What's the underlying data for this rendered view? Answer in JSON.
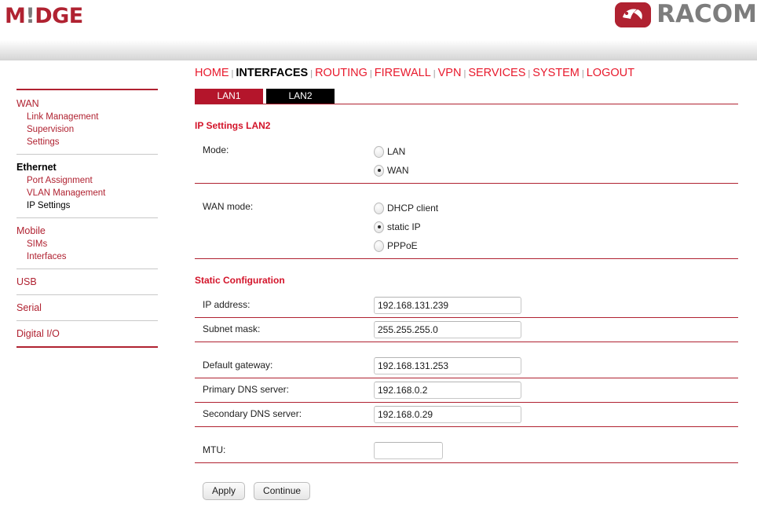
{
  "header": {
    "product_name": "M!DGE",
    "product_name_prefix": "M",
    "product_name_bang": "!",
    "product_name_suffix": "DGE",
    "company_name": "RACOM",
    "logo_icon": "racom-leaf-icon"
  },
  "topnav": {
    "items": [
      {
        "label": "HOME",
        "active": false
      },
      {
        "label": "INTERFACES",
        "active": true
      },
      {
        "label": "ROUTING",
        "active": false
      },
      {
        "label": "FIREWALL",
        "active": false
      },
      {
        "label": "VPN",
        "active": false
      },
      {
        "label": "SERVICES",
        "active": false
      },
      {
        "label": "SYSTEM",
        "active": false
      },
      {
        "label": "LOGOUT",
        "active": false
      }
    ],
    "separator": "|"
  },
  "tabs": [
    {
      "label": "LAN1",
      "state": "red"
    },
    {
      "label": "LAN2",
      "state": "black"
    }
  ],
  "sidebar": {
    "groups": [
      {
        "head": "WAN",
        "head_active": false,
        "items": [
          {
            "label": "Link Management",
            "current": false
          },
          {
            "label": "Supervision",
            "current": false
          },
          {
            "label": "Settings",
            "current": false
          }
        ]
      },
      {
        "head": "Ethernet",
        "head_active": true,
        "items": [
          {
            "label": "Port Assignment",
            "current": false
          },
          {
            "label": "VLAN Management",
            "current": false
          },
          {
            "label": "IP Settings",
            "current": true
          }
        ]
      },
      {
        "head": "Mobile",
        "head_active": false,
        "items": [
          {
            "label": "SIMs",
            "current": false
          },
          {
            "label": "Interfaces",
            "current": false
          }
        ]
      },
      {
        "head": "USB",
        "head_active": false,
        "items": []
      },
      {
        "head": "Serial",
        "head_active": false,
        "items": []
      },
      {
        "head": "Digital I/O",
        "head_active": false,
        "items": []
      }
    ]
  },
  "main": {
    "section_ip_settings_title": "IP Settings LAN2",
    "mode": {
      "label": "Mode:",
      "options": [
        {
          "label": "LAN",
          "selected": false
        },
        {
          "label": "WAN",
          "selected": true
        }
      ],
      "selected_value": "WAN"
    },
    "wan_mode": {
      "label": "WAN mode:",
      "options": [
        {
          "label": "DHCP client",
          "selected": false
        },
        {
          "label": "static IP",
          "selected": true
        },
        {
          "label": "PPPoE",
          "selected": false
        }
      ],
      "selected_value": "static IP"
    },
    "section_static_title": "Static Configuration",
    "fields": {
      "ip_address": {
        "label": "IP address:",
        "value": "192.168.131.239",
        "placeholder": ""
      },
      "subnet_mask": {
        "label": "Subnet mask:",
        "value": "255.255.255.0",
        "placeholder": ""
      },
      "default_gateway": {
        "label": "Default gateway:",
        "value": "192.168.131.253",
        "placeholder": ""
      },
      "primary_dns": {
        "label": "Primary DNS server:",
        "value": "192.168.0.2",
        "placeholder": ""
      },
      "secondary_dns": {
        "label": "Secondary DNS server:",
        "value": "192.168.0.29",
        "placeholder": ""
      },
      "mtu": {
        "label": "MTU:",
        "value": "",
        "placeholder": ""
      }
    },
    "buttons": {
      "apply": "Apply",
      "continue": "Continue"
    }
  },
  "colors": {
    "brand_red": "#b02231",
    "nav_red": "#e8192c",
    "section_red": "#d3142a",
    "tab_red": "#b4152b",
    "tab_black": "#000000",
    "logo_gray": "#7d7d7d"
  }
}
